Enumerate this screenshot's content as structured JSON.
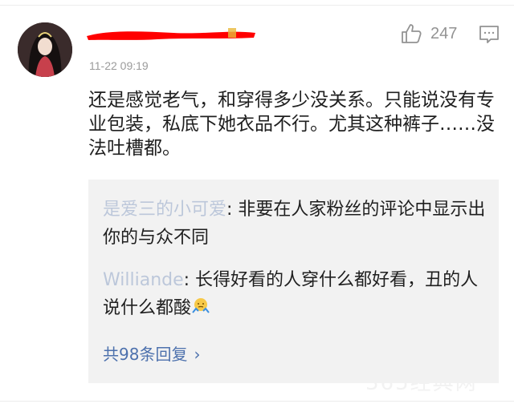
{
  "comment": {
    "username": "",
    "timestamp": "11-22 09:19",
    "like_count": "247",
    "text": "还是感觉老气，和穿得多少没关系。只能说没有专业包装，私底下她衣品不行。尤其这种裤子……没法吐槽都。"
  },
  "replies": [
    {
      "user": "是爱三的小可爱",
      "text": ": 非要在人家粉丝的评论中显示出你的与众不同"
    },
    {
      "user": "Williande",
      "text": ": 长得好看的人穿什么都好看，丑的人说什么都酸"
    }
  ],
  "view_all_label": "共98条回复",
  "view_all_chevron": "›",
  "watermark": "365经典网",
  "colors": {
    "link": "#4d71ad",
    "redaction": "#ff0000",
    "reply_bg": "#f2f2f2",
    "meta": "#9b9b9b"
  },
  "icons": {
    "like": "thumbs-up-icon",
    "comment": "comment-icon",
    "emoji": "shrug-emoji-icon"
  }
}
